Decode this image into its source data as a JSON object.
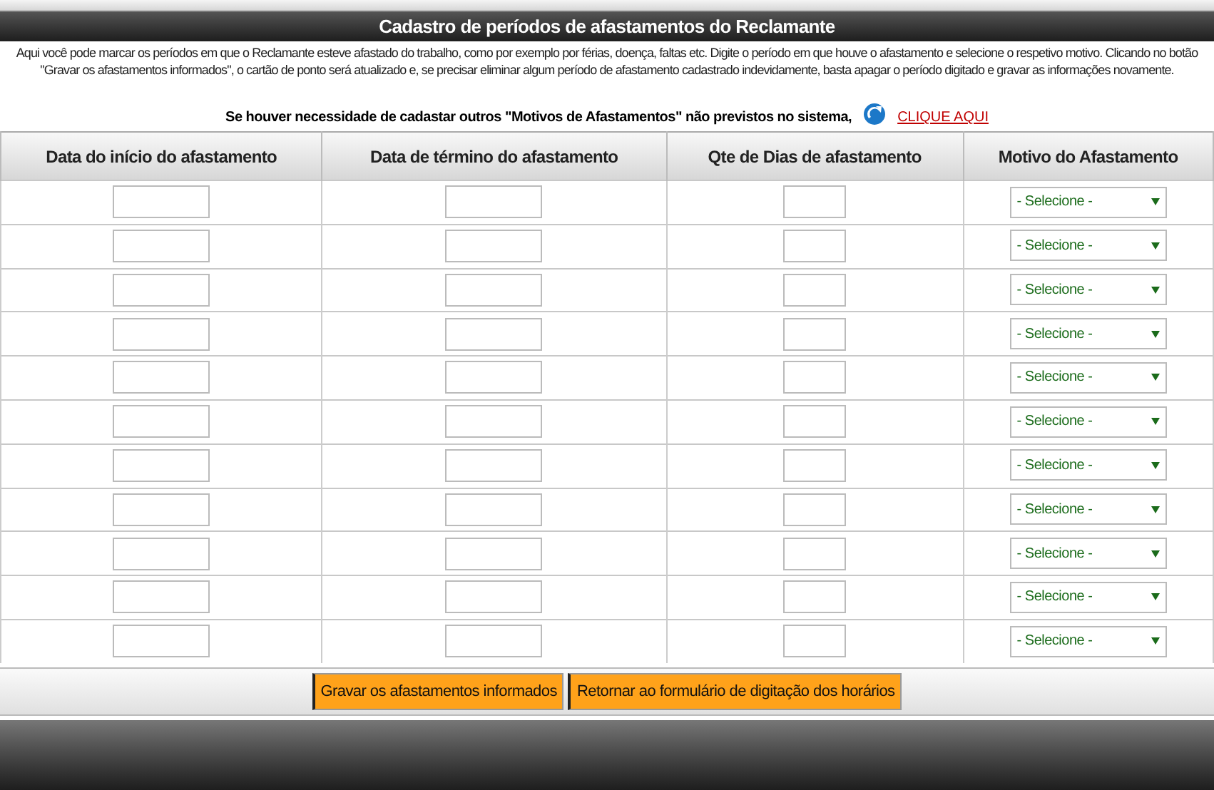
{
  "title": "Cadastro de períodos de afastamentos do Reclamante",
  "description": "Aqui você pode marcar os períodos em que o Reclamante esteve afastado do trabalho, como por exemplo por férias, doença, faltas etc. Digite o período em que houve o afastamento e selecione o respetivo motivo. Clicando no botão \"Gravar os afastamentos informados\", o cartão de ponto será atualizado e, se precisar eliminar algum período de afastamento cadastrado indevidamente, basta apagar o período digitado e gravar as informações novamente.",
  "notice": "Se houver necessidade de cadastar outros \"Motivos de Afastamentos\" não previstos no sistema,",
  "link": "CLIQUE AQUI",
  "columns": [
    "Data do início do afastamento",
    "Data de término do afastamento",
    "Qte de Dias de afastamento",
    "Motivo do Afastamento"
  ],
  "rows": [
    {
      "motivo": "- Selecione -"
    },
    {
      "motivo": "- Selecione -"
    },
    {
      "motivo": "- Selecione -"
    },
    {
      "motivo": "- Selecione -"
    },
    {
      "motivo": "- Selecione -"
    },
    {
      "motivo": "- Selecione -"
    },
    {
      "motivo": "- Selecione -"
    },
    {
      "motivo": "- Selecione -"
    },
    {
      "motivo": "- Selecione -"
    },
    {
      "motivo": "- Selecione -"
    },
    {
      "motivo": "- Selecione -"
    }
  ],
  "buttons": [
    "Gravar os afastamentos informados",
    "Retornar ao formulário de digitação dos horários"
  ]
}
